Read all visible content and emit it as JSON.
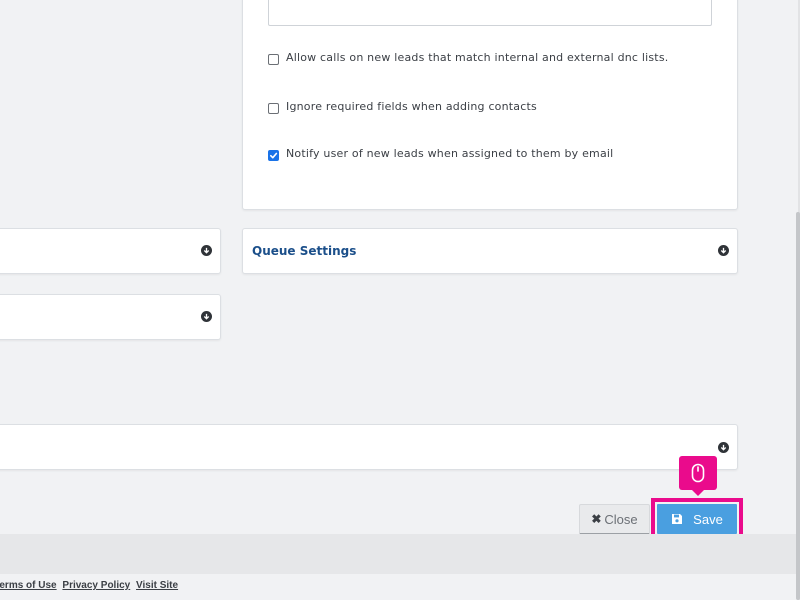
{
  "options": {
    "allow_calls_label": "Allow calls on new leads that match internal and external dnc lists.",
    "allow_calls_checked": false,
    "ignore_required_label": "Ignore required fields when adding contacts",
    "ignore_required_checked": false,
    "notify_user_label": "Notify user of new leads when assigned to them by email",
    "notify_user_checked": true
  },
  "panels": {
    "queue_settings_title": "Queue Settings"
  },
  "buttons": {
    "close_label": "Close",
    "save_label": "Save"
  },
  "footer": {
    "terms_label": "Terms of Use",
    "privacy_label": "Privacy Policy",
    "visit_label": "Visit Site"
  },
  "colors": {
    "accent_highlight": "#ea0b8c",
    "save_button": "#4a9fe0",
    "panel_title": "#1b4f8a"
  },
  "icons": {
    "panel_toggle": "circle-arrow-down-icon",
    "save": "floppy-disk-icon",
    "close": "x-icon",
    "cursor_hint": "mouse-icon"
  }
}
